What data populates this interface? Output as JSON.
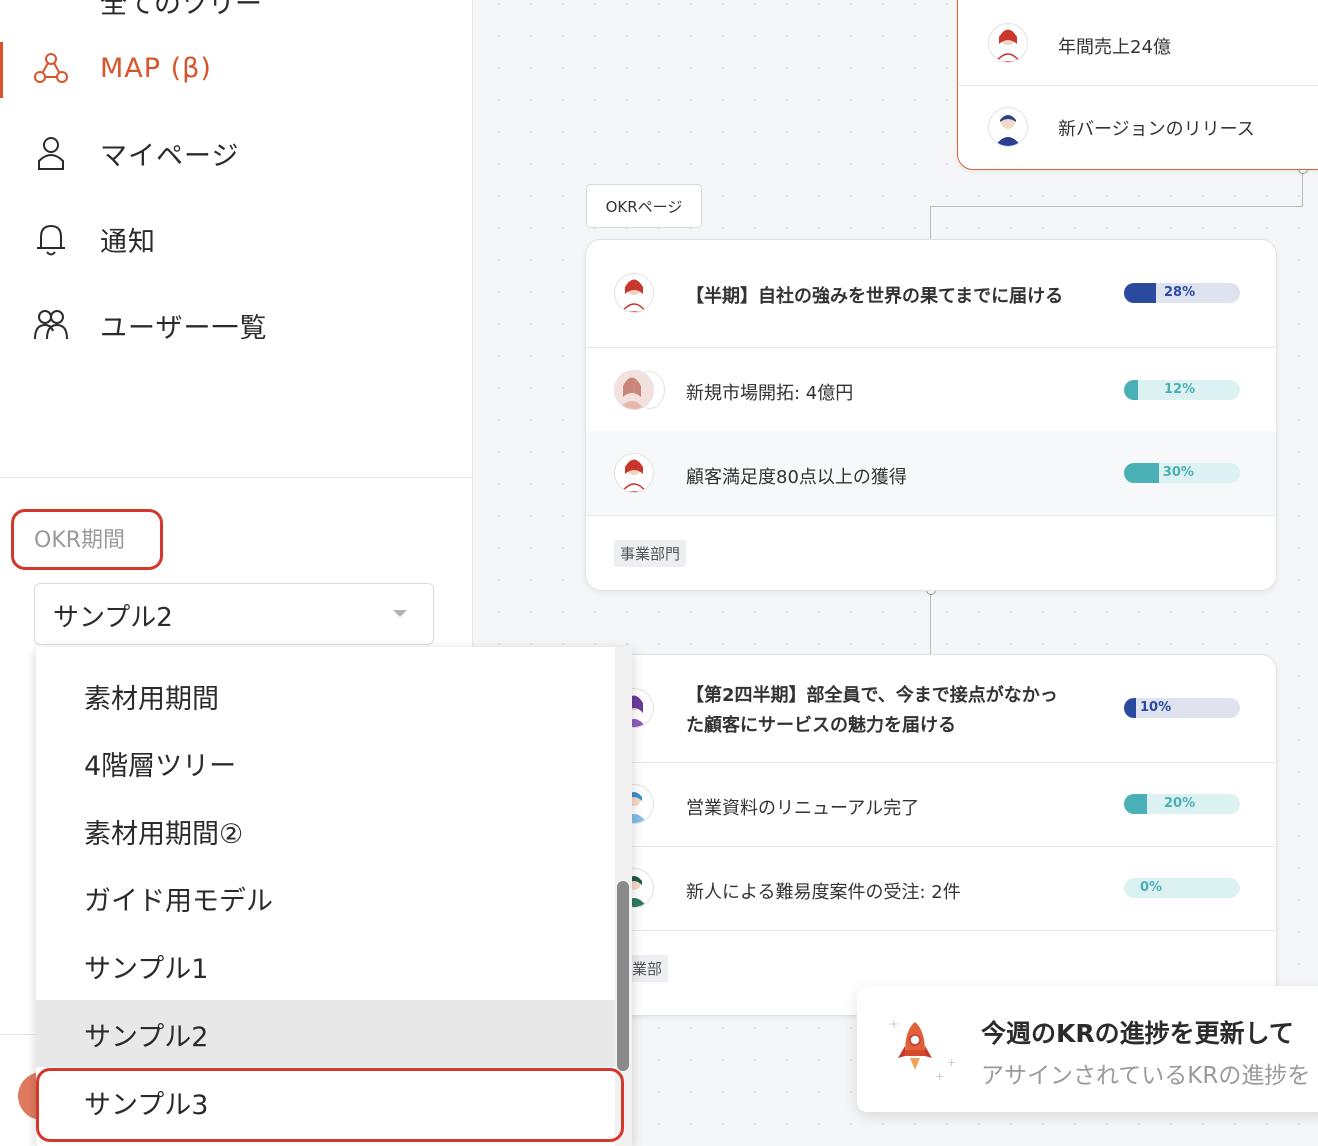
{
  "sidebar": {
    "top_cut_label": "全てのツリー",
    "nav": [
      {
        "label": "MAP (β)",
        "icon": "map-icon",
        "active": true
      },
      {
        "label": "マイページ",
        "icon": "user-icon",
        "active": false
      },
      {
        "label": "通知",
        "icon": "bell-icon",
        "active": false
      },
      {
        "label": "ユーザー一覧",
        "icon": "users-icon",
        "active": false
      }
    ],
    "period_label": "OKR期間",
    "period_select_value": "サンプル2",
    "period_options": [
      "素材用期間",
      "4階層ツリー",
      "素材用期間②",
      "ガイド用モデル",
      "サンプル1",
      "サンプル2",
      "サンプル3"
    ],
    "selected_option": "サンプル2",
    "highlighted_option": "サンプル3"
  },
  "map": {
    "top_card": {
      "rows": [
        {
          "text": "年間売上24億"
        },
        {
          "text": "新バージョンのリリース"
        }
      ]
    },
    "okr_page_button": "OKRページ",
    "card1": {
      "objective": "【半期】自社の強みを世界の果てまでに届ける",
      "objective_progress": "28%",
      "objective_value": 0.28,
      "krs": [
        {
          "text": "新規市場開拓: 4億円",
          "progress": "12%",
          "value": 0.12
        },
        {
          "text": "顧客満足度80点以上の獲得",
          "progress": "30%",
          "value": 0.3
        }
      ],
      "tag": "事業部門"
    },
    "card2": {
      "objective_line1": "【第2四半期】部全員で、今まで接点がなかっ",
      "objective_line2": "た顧客にサービスの魅力を届ける",
      "objective_progress": "10%",
      "objective_value": 0.1,
      "krs": [
        {
          "text": "営業資料のリニューアル完了",
          "progress": "20%",
          "value": 0.2
        },
        {
          "text": "新人による難易度案件の受注: 2件",
          "progress": "0%",
          "value": 0.0
        }
      ],
      "tag": "業部"
    }
  },
  "toast": {
    "title": "今週のKRの進捗を更新して",
    "body": "アサインされているKRの進捗を"
  },
  "colors": {
    "accent": "#d9542b",
    "highlight_border": "#d4382a",
    "objective_bar": "#2a4aa0",
    "objective_track": "#dfe3f0",
    "kr_bar": "#4bb0b5",
    "kr_track": "#dcf1f2"
  }
}
